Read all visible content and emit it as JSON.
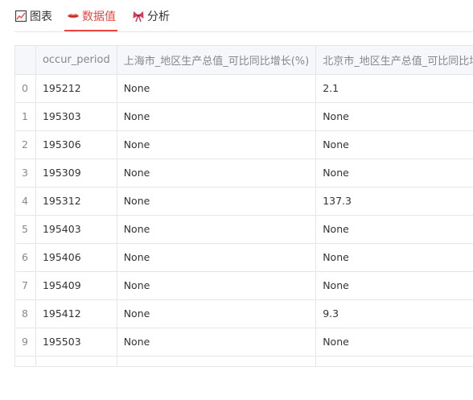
{
  "tabs": [
    {
      "label": "图表",
      "icon": "chart-icon",
      "active": false
    },
    {
      "label": "数据值",
      "icon": "lips-icon",
      "active": true
    },
    {
      "label": "分析",
      "icon": "bow-icon",
      "active": false
    }
  ],
  "colors": {
    "accent": "#e8483f",
    "border": "#e6e6e6",
    "header_bg": "#f5f7fa"
  },
  "table": {
    "columns": [
      "",
      "occur_period",
      "上海市_地区生产总值_可比同比增长(%)",
      "北京市_地区生产总值_可比同比增长(%)"
    ],
    "rows": [
      [
        "0",
        "195212",
        "None",
        "2.1"
      ],
      [
        "1",
        "195303",
        "None",
        "None"
      ],
      [
        "2",
        "195306",
        "None",
        "None"
      ],
      [
        "3",
        "195309",
        "None",
        "None"
      ],
      [
        "4",
        "195312",
        "None",
        "137.3"
      ],
      [
        "5",
        "195403",
        "None",
        "None"
      ],
      [
        "6",
        "195406",
        "None",
        "None"
      ],
      [
        "7",
        "195409",
        "None",
        "None"
      ],
      [
        "8",
        "195412",
        "None",
        "9.3"
      ],
      [
        "9",
        "195503",
        "None",
        "None"
      ]
    ]
  }
}
